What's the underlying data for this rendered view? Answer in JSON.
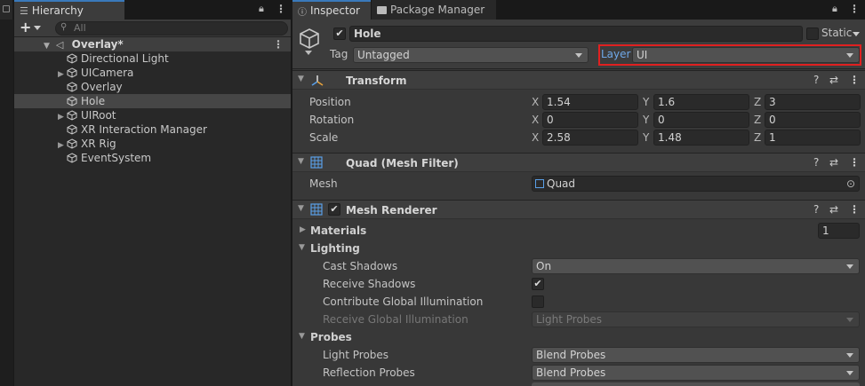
{
  "hierarchy": {
    "tab_label": "Hierarchy",
    "search_placeholder": "All",
    "add_label": "+",
    "scene": "Overlay*",
    "items": [
      {
        "label": "Directional Light",
        "foldable": false
      },
      {
        "label": "UICamera",
        "foldable": true
      },
      {
        "label": "Overlay",
        "foldable": false
      },
      {
        "label": "Hole",
        "foldable": false,
        "selected": true
      },
      {
        "label": "UIRoot",
        "foldable": true
      },
      {
        "label": "XR Interaction Manager",
        "foldable": false
      },
      {
        "label": "XR Rig",
        "foldable": true
      },
      {
        "label": "EventSystem",
        "foldable": false
      }
    ]
  },
  "inspector": {
    "tab_label": "Inspector",
    "package_tab_label": "Package Manager",
    "object_name": "Hole",
    "static_label": "Static",
    "tag_label": "Tag",
    "tag_value": "Untagged",
    "layer_label": "Layer",
    "layer_value": "UI",
    "transform": {
      "title": "Transform",
      "position_label": "Position",
      "rotation_label": "Rotation",
      "scale_label": "Scale",
      "position": {
        "x": "1.54",
        "y": "1.6",
        "z": "3"
      },
      "rotation": {
        "x": "0",
        "y": "0",
        "z": "0"
      },
      "scale": {
        "x": "2.58",
        "y": "1.48",
        "z": "1"
      }
    },
    "mesh_filter": {
      "title": "Quad (Mesh Filter)",
      "mesh_label": "Mesh",
      "mesh_value": "Quad"
    },
    "mesh_renderer": {
      "title": "Mesh Renderer",
      "materials_label": "Materials",
      "materials_count": "1",
      "lighting_label": "Lighting",
      "cast_shadows_label": "Cast Shadows",
      "cast_shadows_value": "On",
      "receive_shadows_label": "Receive Shadows",
      "contribute_gi_label": "Contribute Global Illumination",
      "receive_gi_label": "Receive Global Illumination",
      "receive_gi_value": "Light Probes",
      "probes_label": "Probes",
      "light_probes_label": "Light Probes",
      "light_probes_value": "Blend Probes",
      "reflection_probes_label": "Reflection Probes",
      "reflection_probes_value": "Blend Probes"
    }
  },
  "axis": {
    "x": "X",
    "y": "Y",
    "z": "Z"
  },
  "colors": {
    "highlight": "#e02020",
    "tab_accent": "#3a79bb",
    "layer_label": "#6fa8e8"
  }
}
